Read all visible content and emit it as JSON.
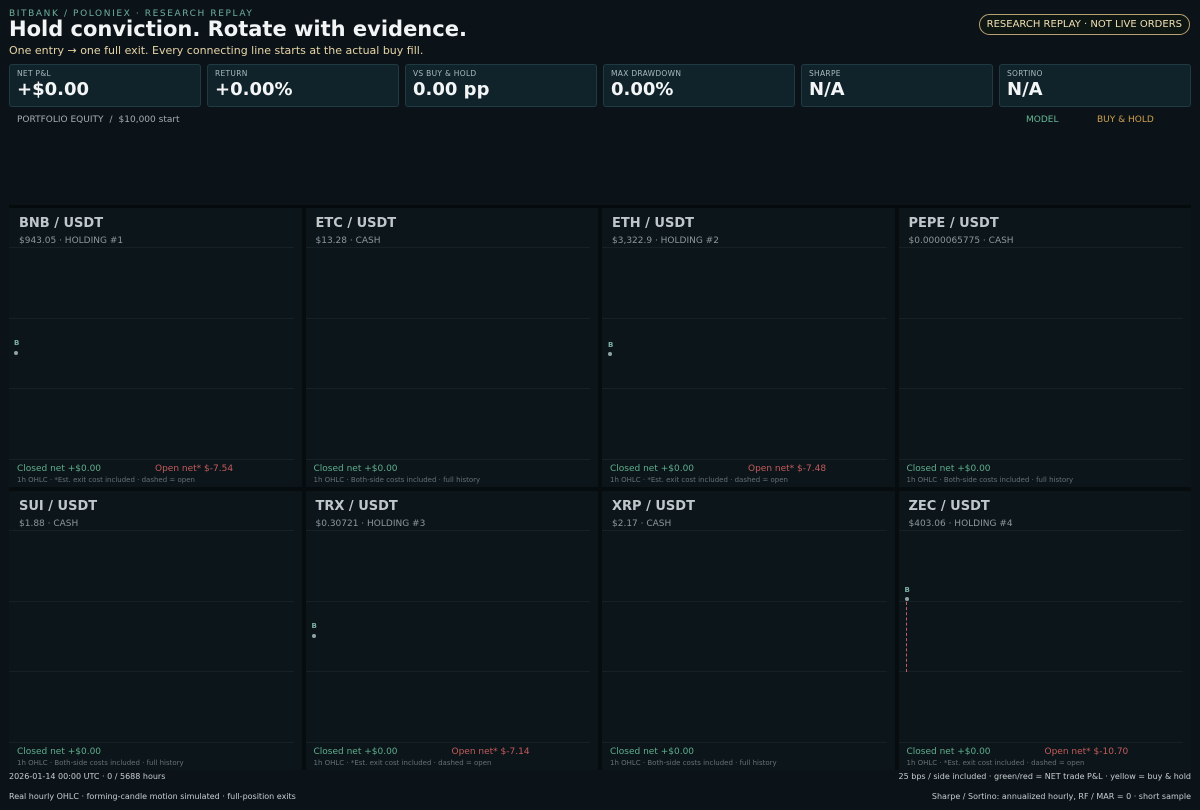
{
  "header": {
    "eyebrow": "BITBANK / POLONIEX · RESEARCH REPLAY",
    "title": "Hold conviction. Rotate with evidence.",
    "subtitle": "One entry → one full exit. Every connecting line starts at the actual buy fill.",
    "badge": "RESEARCH REPLAY · NOT LIVE ORDERS"
  },
  "metrics": [
    {
      "label": "NET P&L",
      "value": "+$0.00"
    },
    {
      "label": "RETURN",
      "value": "+0.00%"
    },
    {
      "label": "VS BUY & HOLD",
      "value": "0.00 pp"
    },
    {
      "label": "MAX DRAWDOWN",
      "value": "0.00%"
    },
    {
      "label": "SHARPE",
      "value": "N/A"
    },
    {
      "label": "SORTINO",
      "value": "N/A"
    }
  ],
  "equity": {
    "title": "PORTFOLIO EQUITY",
    "separator": "/",
    "start": "$10,000 start",
    "legend_model": "MODEL",
    "legend_buy_hold": "BUY & HOLD",
    "colors": {
      "model": "#66b694",
      "buy_hold": "#cda04c"
    }
  },
  "panels": [
    {
      "pair": "BNB / USDT",
      "meta": "$943.05 · HOLDING #1",
      "closed": "Closed net +$0.00",
      "open": "Open net* $-7.54",
      "foot": "1h OHLC · *Est. exit cost included · dashed = open",
      "buy_marker": "B",
      "has_marker": true
    },
    {
      "pair": "ETC / USDT",
      "meta": "$13.28 · CASH",
      "closed": "Closed net +$0.00",
      "open": "",
      "foot": "1h OHLC · Both-side costs included · full history",
      "buy_marker": "",
      "has_marker": false
    },
    {
      "pair": "ETH / USDT",
      "meta": "$3,322.9 · HOLDING #2",
      "closed": "Closed net +$0.00",
      "open": "Open net* $-7.48",
      "foot": "1h OHLC · *Est. exit cost included · dashed = open",
      "buy_marker": "B",
      "has_marker": true
    },
    {
      "pair": "PEPE / USDT",
      "meta": "$0.0000065775 · CASH",
      "closed": "Closed net +$0.00",
      "open": "",
      "foot": "1h OHLC · Both-side costs included · full history",
      "buy_marker": "",
      "has_marker": false
    },
    {
      "pair": "SUI / USDT",
      "meta": "$1.88 · CASH",
      "closed": "Closed net +$0.00",
      "open": "",
      "foot": "1h OHLC · Both-side costs included · full history",
      "buy_marker": "",
      "has_marker": false
    },
    {
      "pair": "TRX / USDT",
      "meta": "$0.30721 · HOLDING #3",
      "closed": "Closed net +$0.00",
      "open": "Open net* $-7.14",
      "foot": "1h OHLC · *Est. exit cost included · dashed = open",
      "buy_marker": "B",
      "has_marker": true
    },
    {
      "pair": "XRP / USDT",
      "meta": "$2.17 · CASH",
      "closed": "Closed net +$0.00",
      "open": "",
      "foot": "1h OHLC · Both-side costs included · full history",
      "buy_marker": "",
      "has_marker": false
    },
    {
      "pair": "ZEC / USDT",
      "meta": "$403.06 · HOLDING #4",
      "closed": "Closed net +$0.00",
      "open": "Open net* $-10.70",
      "foot": "1h OHLC · *Est. exit cost included · dashed = open",
      "buy_marker": "B",
      "has_marker": true
    }
  ],
  "status": {
    "left": "2026-01-14 00:00 UTC · 0 / 5688 hours",
    "right": "25 bps / side included · green/red = NET trade P&L · yellow = buy & hold",
    "foot_left": "Real hourly OHLC · forming-candle motion simulated · full-position exits",
    "foot_right": "Sharpe / Sortino: annualized hourly, RF / MAR = 0 · short sample"
  }
}
